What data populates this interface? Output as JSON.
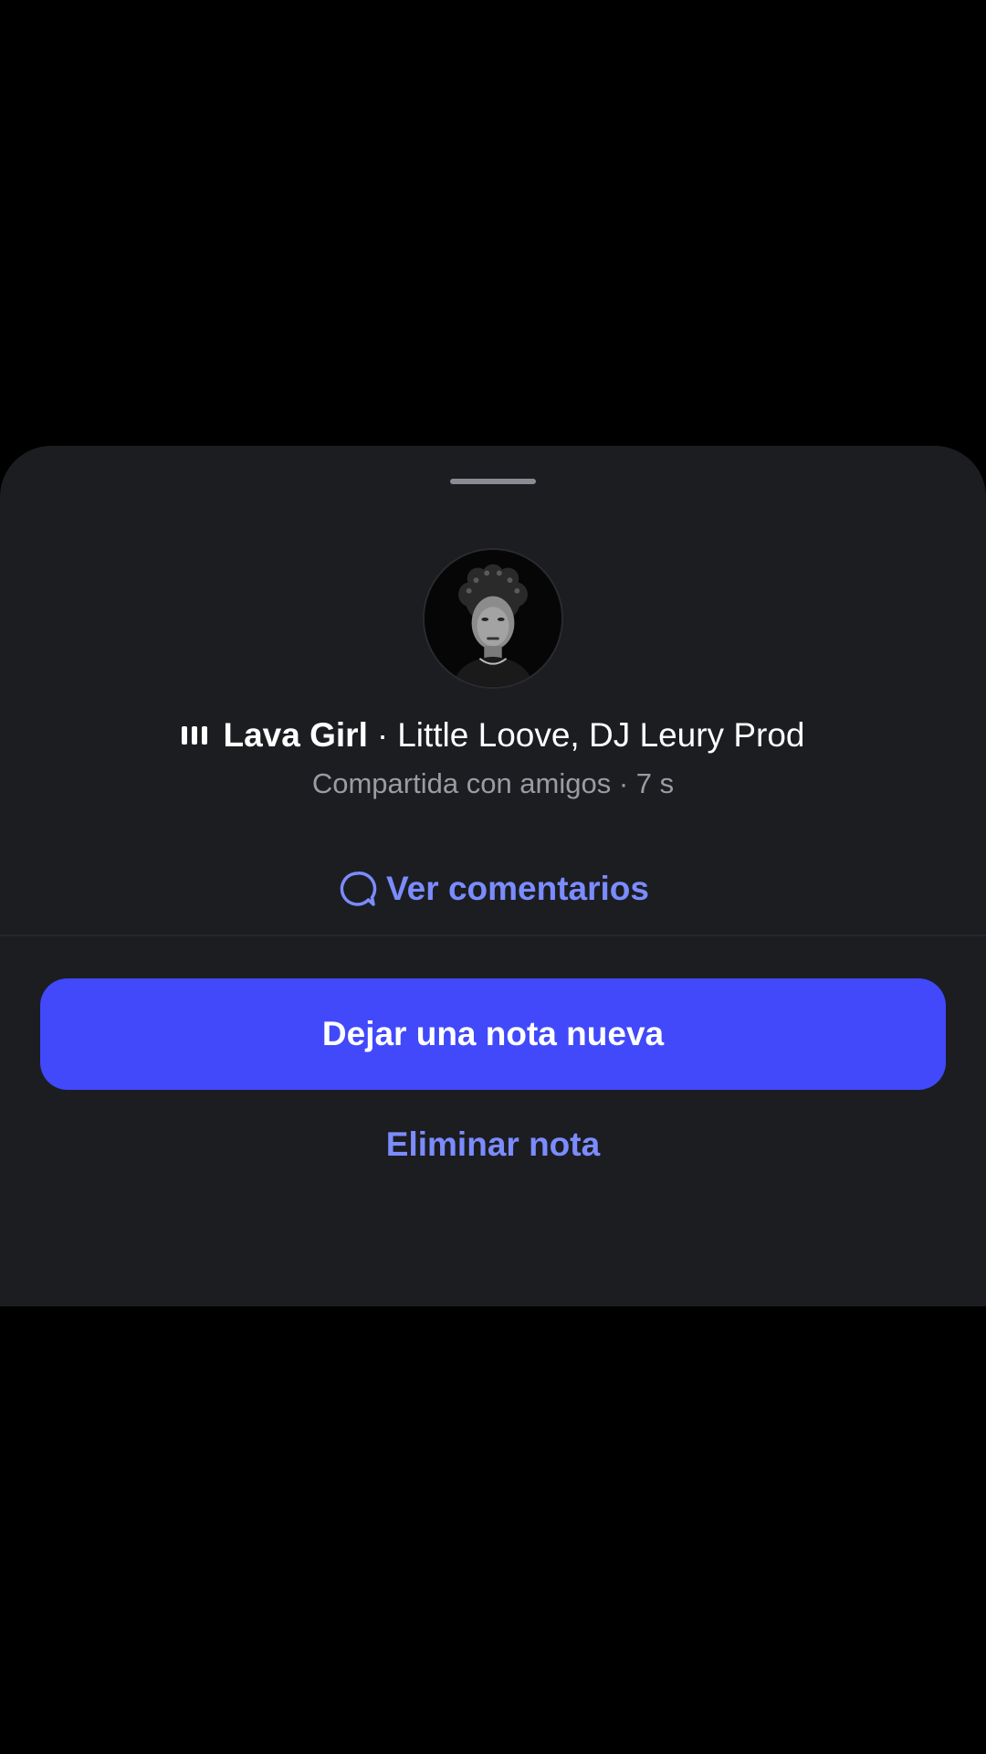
{
  "note": {
    "song_title": "Lava Girl",
    "separator": "·",
    "artists": "Little Loove, DJ Leury Prod",
    "shared_with": "Compartida con amigos · 7 s"
  },
  "actions": {
    "view_comments": "Ver comentarios",
    "new_note": "Dejar una nota nueva",
    "delete_note": "Eliminar nota"
  },
  "icons": {
    "music": "music-bars-icon",
    "comment": "comment-bubble-icon"
  },
  "colors": {
    "sheet_background": "#1c1d21",
    "primary_button": "#4149fb",
    "link": "#7b8cff",
    "secondary_text": "#9a9ca3"
  }
}
